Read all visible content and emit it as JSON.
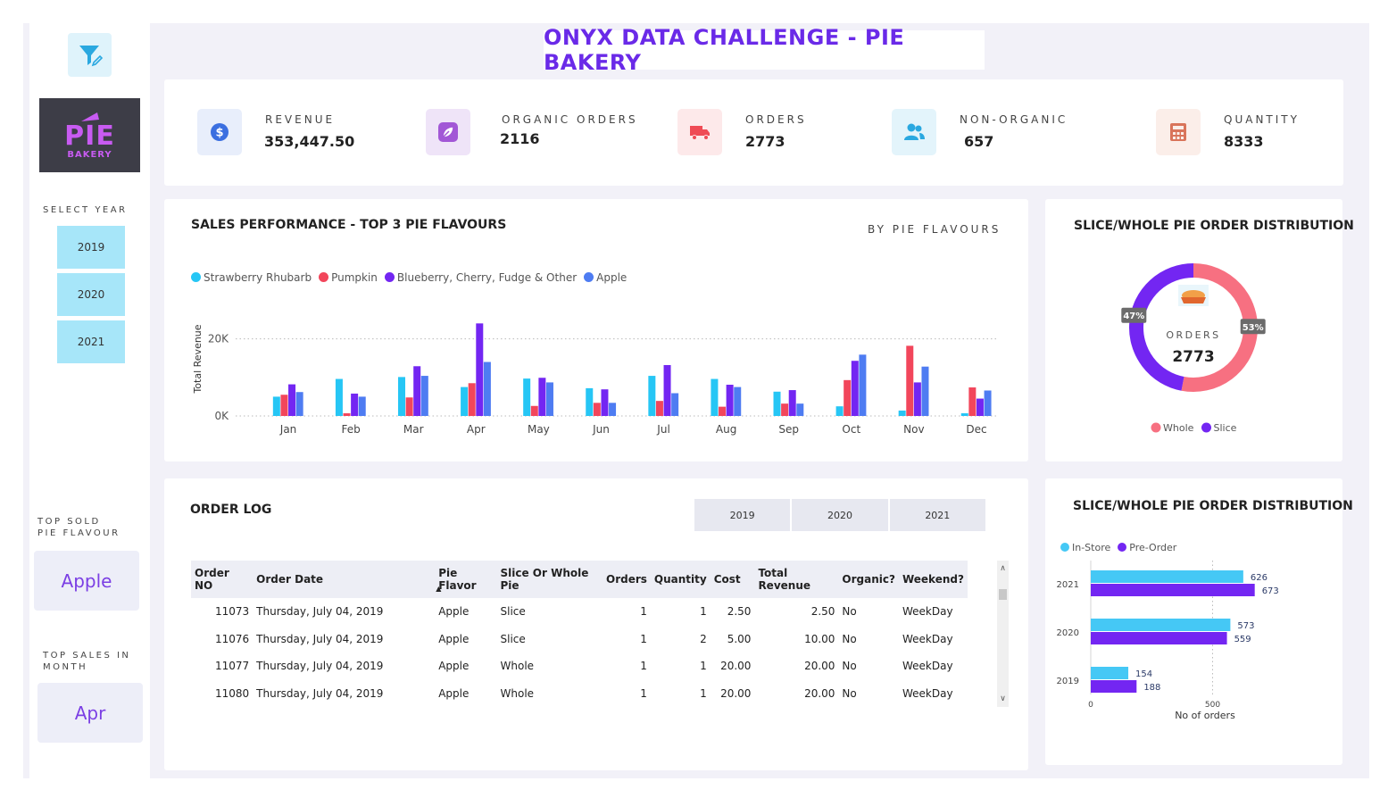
{
  "header": {
    "title": "ONYX DATA CHALLENGE - PIE BAKERY"
  },
  "sidebar": {
    "logo_main": "PIE",
    "logo_sub": "BAKERY",
    "select_year_label": "SELECT YEAR",
    "years": [
      "2019",
      "2020",
      "2021"
    ],
    "top_flavour_label_1": "TOP SOLD",
    "top_flavour_label_2": "PIE FLAVOUR",
    "top_flavour_value": "Apple",
    "top_month_label_1": "TOP SALES IN",
    "top_month_label_2": "MONTH",
    "top_month_value": "Apr"
  },
  "kpis": [
    {
      "label": "REVENUE",
      "value": "353,447.50",
      "icon": "dollar-icon",
      "bg": "#e8eefb",
      "color": "#3b6fe0"
    },
    {
      "label": "ORGANIC ORDERS",
      "value": "2116",
      "icon": "leaf-icon",
      "bg": "#efe4f8",
      "color": "#a257d6"
    },
    {
      "label": "ORDERS",
      "value": "2773",
      "icon": "truck-icon",
      "bg": "#fde9ea",
      "color": "#ef4b55"
    },
    {
      "label": "NON-ORGANIC",
      "value": "657",
      "icon": "users-icon",
      "bg": "#e3f4fb",
      "color": "#2aa8e0"
    },
    {
      "label": "QUANTITY",
      "value": "8333",
      "icon": "calculator-icon",
      "bg": "#fbeee9",
      "color": "#d9745a"
    }
  ],
  "sales_chart": {
    "title": "SALES PERFORMANCE - TOP 3 PIE FLAVOURS",
    "subtitle": "BY PIE FLAVOURS"
  },
  "chart_data": [
    {
      "type": "bar",
      "title": "SALES PERFORMANCE - TOP 3 PIE FLAVOURS",
      "ylabel": "Total Revenue",
      "xlabel": "",
      "ylim": [
        0,
        25000
      ],
      "yticks": [
        "0K",
        "20K"
      ],
      "categories": [
        "Jan",
        "Feb",
        "Mar",
        "Apr",
        "May",
        "Jun",
        "Jul",
        "Aug",
        "Sep",
        "Oct",
        "Nov",
        "Dec"
      ],
      "series": [
        {
          "name": "Strawberry Rhubarb",
          "color": "#26c6f5",
          "values": [
            5000,
            9600,
            10100,
            7500,
            9700,
            7200,
            10400,
            9600,
            6300,
            2500,
            1400,
            700
          ]
        },
        {
          "name": "Pumpkin",
          "color": "#f2465b",
          "values": [
            5500,
            700,
            4800,
            8500,
            2600,
            3400,
            3900,
            2400,
            3200,
            9300,
            18200,
            7400
          ]
        },
        {
          "name": "Blueberry, Cherry, Fudge & Other",
          "color": "#7326f2",
          "values": [
            8200,
            5800,
            12900,
            24000,
            9900,
            6900,
            13200,
            8100,
            6700,
            14300,
            8700,
            4500
          ]
        },
        {
          "name": "Apple",
          "color": "#4e7cf2",
          "values": [
            6200,
            5000,
            10400,
            14000,
            8700,
            3400,
            5900,
            7500,
            3200,
            15900,
            12800,
            6600
          ]
        }
      ]
    },
    {
      "type": "pie",
      "title": "SLICE/WHOLE PIE ORDER DISTRIBUTION",
      "center_label": "ORDERS",
      "center_value": "2773",
      "slices": [
        {
          "name": "Whole",
          "value": 53,
          "label": "53%",
          "color": "#f77081"
        },
        {
          "name": "Slice",
          "value": 47,
          "label": "47%",
          "color": "#7326f2"
        }
      ]
    },
    {
      "type": "bar",
      "orientation": "horizontal",
      "title": "SLICE/WHOLE PIE ORDER DISTRIBUTION",
      "xlabel": "No of orders",
      "xlim": [
        0,
        850
      ],
      "xticks": [
        "0",
        "500"
      ],
      "categories": [
        "2021",
        "2020",
        "2019"
      ],
      "series": [
        {
          "name": "In-Store",
          "color": "#45c8f5",
          "values": [
            626,
            573,
            154
          ]
        },
        {
          "name": "Pre-Order",
          "color": "#7326f2",
          "values": [
            673,
            559,
            188
          ]
        }
      ]
    }
  ],
  "order_log": {
    "title": "ORDER LOG",
    "tabs": [
      "2019",
      "2020",
      "2021"
    ],
    "columns": [
      "Order NO",
      "Order Date",
      "Pie Flavor",
      "Slice Or Whole Pie",
      "Orders",
      "Quantity",
      "Cost",
      "Total Revenue",
      "Organic?",
      "Weekend?"
    ],
    "rows": [
      [
        "11073",
        "Thursday, July 04, 2019",
        "Apple",
        "Slice",
        "1",
        "1",
        "2.50",
        "2.50",
        "No",
        "WeekDay"
      ],
      [
        "11076",
        "Thursday, July 04, 2019",
        "Apple",
        "Slice",
        "1",
        "2",
        "5.00",
        "10.00",
        "No",
        "WeekDay"
      ],
      [
        "11077",
        "Thursday, July 04, 2019",
        "Apple",
        "Whole",
        "1",
        "1",
        "20.00",
        "20.00",
        "No",
        "WeekDay"
      ],
      [
        "11080",
        "Thursday, July 04, 2019",
        "Apple",
        "Whole",
        "1",
        "1",
        "20.00",
        "20.00",
        "No",
        "WeekDay"
      ]
    ]
  },
  "donut_card": {
    "title": "SLICE/WHOLE PIE ORDER DISTRIBUTION"
  },
  "hbar_card": {
    "title": "SLICE/WHOLE PIE ORDER DISTRIBUTION"
  }
}
